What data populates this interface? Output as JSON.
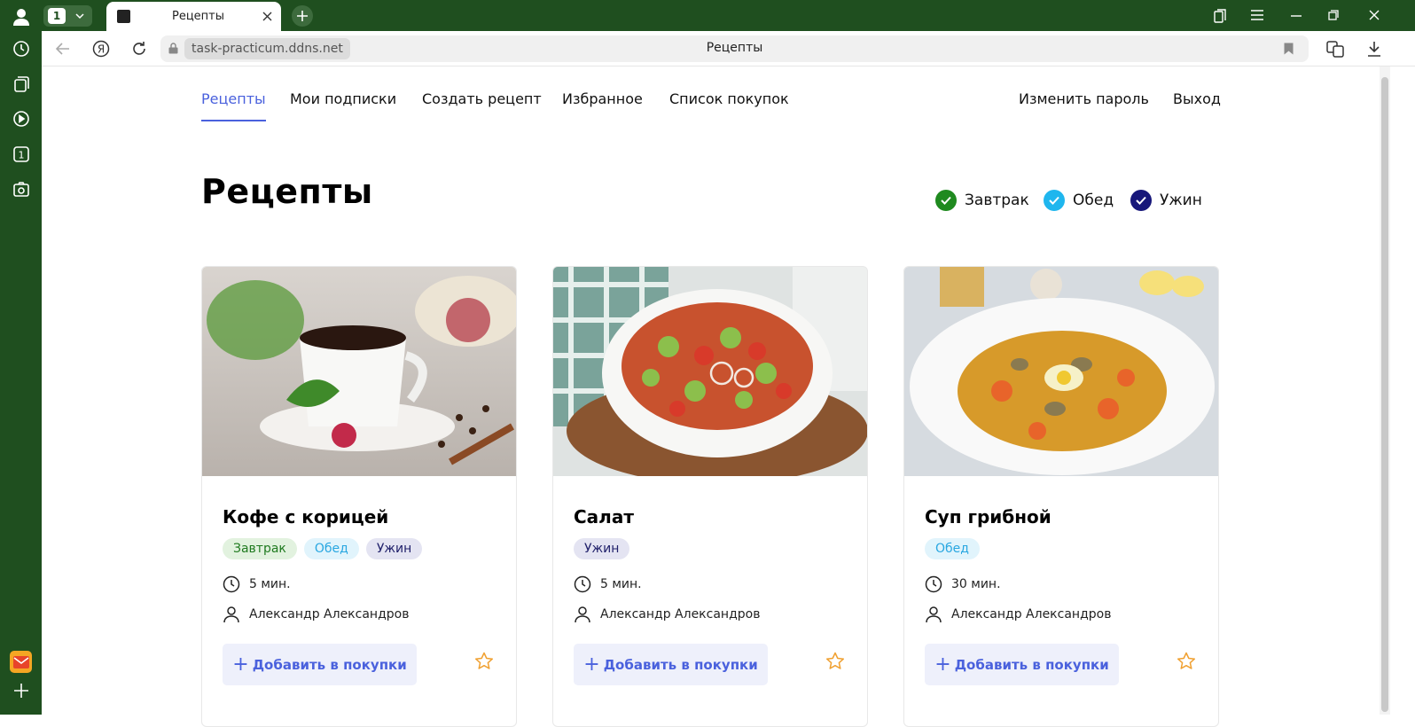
{
  "browser": {
    "tab_count_badge": "1",
    "tab_title": "Рецепты",
    "url": "task-practicum.ddns.net",
    "page_title": "Рецепты"
  },
  "nav": {
    "recipes": "Рецепты",
    "subscriptions": "Мои подписки",
    "create_recipe": "Создать рецепт",
    "favorites": "Избранное",
    "shopping_list": "Список покупок",
    "change_password": "Изменить пароль",
    "logout": "Выход"
  },
  "page": {
    "title": "Рецепты",
    "filters": [
      {
        "label": "Завтрак",
        "color": "#1f8a1f"
      },
      {
        "label": "Обед",
        "color": "#1fb6ee"
      },
      {
        "label": "Ужин",
        "color": "#17177a"
      }
    ]
  },
  "recipes": [
    {
      "title": "Кофе с корицей",
      "tags": [
        "Завтрак",
        "Обед",
        "Ужин"
      ],
      "time": "5 мин.",
      "author": "Александр Александров",
      "add_label": "Добавить в покупки",
      "image": "coffee-cup-photo"
    },
    {
      "title": "Салат",
      "tags": [
        "Ужин"
      ],
      "time": "5 мин.",
      "author": "Александр Александров",
      "add_label": "Добавить в покупки",
      "image": "salad-bowl-photo"
    },
    {
      "title": "Суп грибной",
      "tags": [
        "Обед"
      ],
      "time": "30 мин.",
      "author": "Александр Александров",
      "add_label": "Добавить в покупки",
      "image": "mushroom-soup-photo"
    }
  ],
  "colors": {
    "browser_green": "#1f4f1f",
    "accent_blue": "#4a61dd",
    "star_orange": "#f0a030"
  }
}
